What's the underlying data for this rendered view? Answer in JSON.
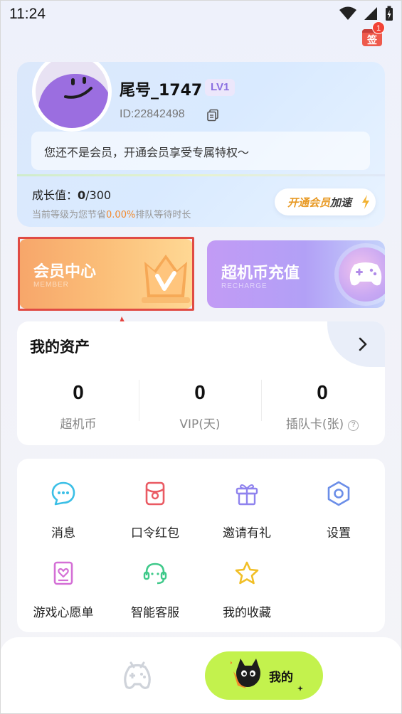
{
  "status_bar": {
    "time": "11:24"
  },
  "signin": {
    "label": "签",
    "badge": "1"
  },
  "profile": {
    "username": "尾号_1747",
    "level": "LV1",
    "user_id": "ID:22842498",
    "promo": "您还不是会员，开通会员享受专属特权～",
    "growth_label": "成长值：",
    "growth_current": "0",
    "growth_total": "/300",
    "growth_sub_prefix": "当前等级为您节省",
    "growth_sub_pct": "0.00%",
    "growth_sub_suffix": "排队等待时长",
    "speed_button_part1": "开通会员",
    "speed_button_part2": "加速"
  },
  "cards": {
    "member": {
      "title": "会员中心",
      "subtitle": "MEMBER"
    },
    "recharge": {
      "title": "超机币充值",
      "subtitle": "RECHARGE"
    }
  },
  "assets": {
    "title": "我的资产",
    "items": [
      {
        "value": "0",
        "label": "超机币"
      },
      {
        "value": "0",
        "label": "VIP(天)"
      },
      {
        "value": "0",
        "label": "插队卡(张)"
      }
    ]
  },
  "menu": {
    "items": [
      {
        "label": "消息",
        "icon": "message-icon"
      },
      {
        "label": "口令红包",
        "icon": "red-packet-icon"
      },
      {
        "label": "邀请有礼",
        "icon": "gift-icon"
      },
      {
        "label": "设置",
        "icon": "settings-icon"
      },
      {
        "label": "游戏心愿单",
        "icon": "wishlist-icon"
      },
      {
        "label": "智能客服",
        "icon": "headset-icon"
      },
      {
        "label": "我的收藏",
        "icon": "star-icon"
      }
    ]
  },
  "bottom_nav": {
    "mine_label": "我的"
  },
  "colors": {
    "accent_orange": "#f28a2e",
    "highlight_red": "#e04b44",
    "nav_active": "#c3f24d",
    "level_purple": "#8a6fe0"
  }
}
